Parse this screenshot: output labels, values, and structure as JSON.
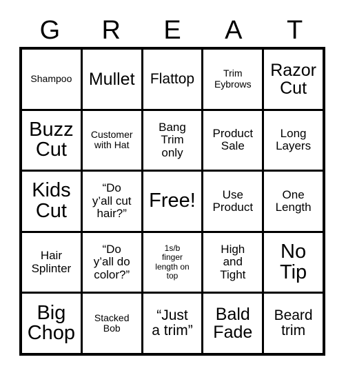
{
  "card": {
    "title_letters": [
      "G",
      "R",
      "E",
      "A",
      "T"
    ],
    "free_space_label": "Free!",
    "colors": {
      "background": "#ffffff",
      "grid_line": "#000000",
      "text": "#000000"
    },
    "rows": [
      [
        {
          "text": "Shampoo",
          "size": "s"
        },
        {
          "text": "Mullet",
          "size": "xl"
        },
        {
          "text": "Flattop",
          "size": "l"
        },
        {
          "text": "Trim\nEybrows",
          "size": "s"
        },
        {
          "text": "Razor\nCut",
          "size": "xl"
        }
      ],
      [
        {
          "text": "Buzz\nCut",
          "size": "xxl"
        },
        {
          "text": "Customer\nwith Hat",
          "size": "s"
        },
        {
          "text": "Bang\nTrim\nonly",
          "size": "m"
        },
        {
          "text": "Product\nSale",
          "size": "m"
        },
        {
          "text": "Long\nLayers",
          "size": "m"
        }
      ],
      [
        {
          "text": "Kids\nCut",
          "size": "xxl"
        },
        {
          "text": "“Do\ny’all cut\nhair?”",
          "size": "m"
        },
        {
          "text": "Free!",
          "size": "xxl"
        },
        {
          "text": "Use\nProduct",
          "size": "m"
        },
        {
          "text": "One\nLength",
          "size": "m"
        }
      ],
      [
        {
          "text": "Hair\nSplinter",
          "size": "m"
        },
        {
          "text": "“Do\ny’all do\ncolor?”",
          "size": "m"
        },
        {
          "text": "1s/b\nfinger\nlength on\ntop",
          "size": "xs"
        },
        {
          "text": "High\nand\nTight",
          "size": "m"
        },
        {
          "text": "No\nTip",
          "size": "xxl"
        }
      ],
      [
        {
          "text": "Big\nChop",
          "size": "xxl"
        },
        {
          "text": "Stacked\nBob",
          "size": "s"
        },
        {
          "text": "“Just\na trim”",
          "size": "l"
        },
        {
          "text": "Bald\nFade",
          "size": "xl"
        },
        {
          "text": "Beard\ntrim",
          "size": "l"
        }
      ]
    ]
  }
}
